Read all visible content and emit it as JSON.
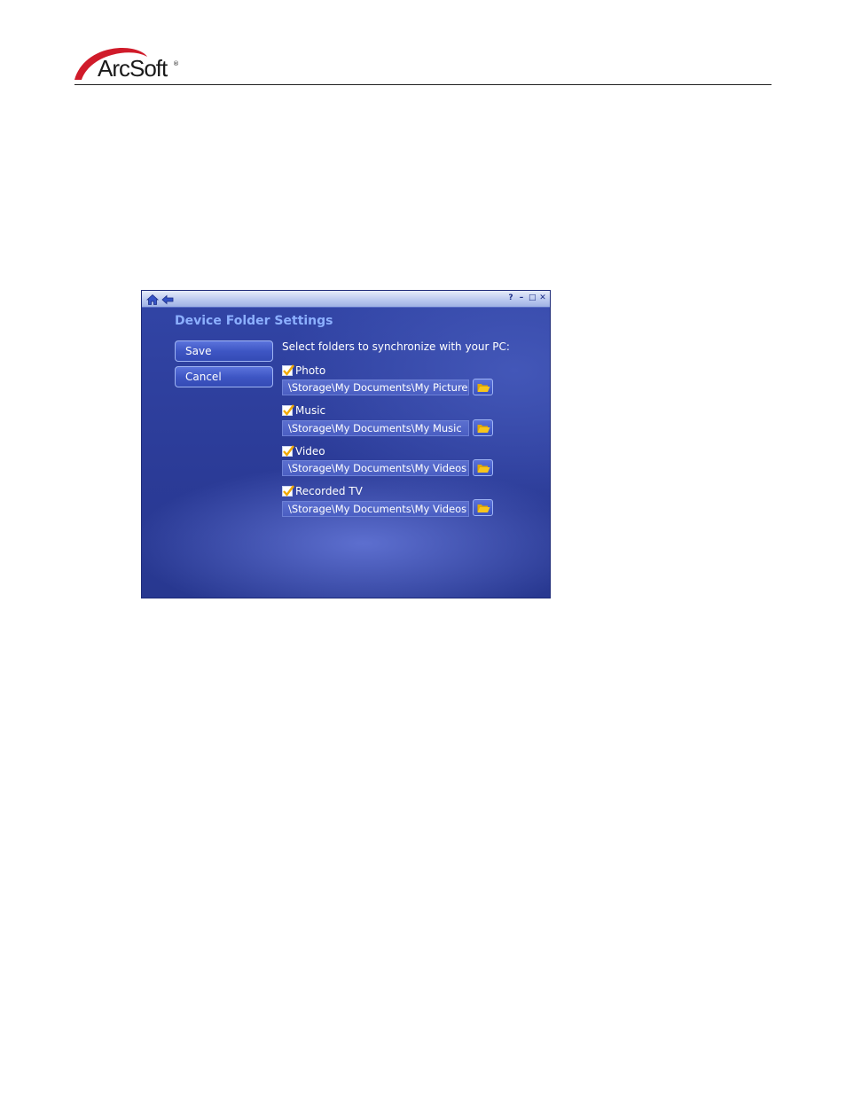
{
  "brand": {
    "logo_text": "ArcSoft",
    "registered_mark": "®",
    "logo_color": "#d01b2a"
  },
  "window": {
    "titlebar_icons_left": [
      "home-icon",
      "back-arrow-icon"
    ],
    "titlebar_icons_right": {
      "help": "?",
      "minimize": "–",
      "maximize": "□",
      "close": "✕"
    },
    "title": "Device Folder Settings",
    "buttons": {
      "save": "Save",
      "cancel": "Cancel"
    },
    "prompt": "Select folders to synchronize with your PC:",
    "folders": [
      {
        "label": "Photo",
        "checked": true,
        "path": "\\Storage\\My Documents\\My Pictures"
      },
      {
        "label": "Music",
        "checked": true,
        "path": "\\Storage\\My Documents\\My Music"
      },
      {
        "label": "Video",
        "checked": true,
        "path": "\\Storage\\My Documents\\My Videos"
      },
      {
        "label": "Recorded TV",
        "checked": true,
        "path": "\\Storage\\My Documents\\My Videos"
      }
    ],
    "colors": {
      "background": "#2f42a2",
      "title_text": "#8cb0ff",
      "checkmark": "#f2a900",
      "folder_icon": "#f7c51e"
    }
  }
}
